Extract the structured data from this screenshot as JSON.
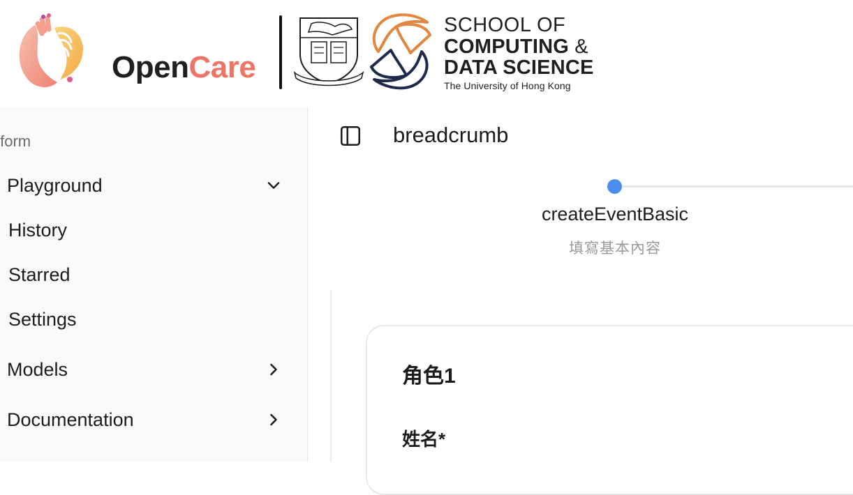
{
  "header": {
    "brand_open": "Open",
    "brand_care": "Care",
    "school": {
      "line1": "SCHOOL OF",
      "line2_main": "COMPUTING",
      "line2_amp": "&",
      "line3": "DATA SCIENCE",
      "line4": "The University of Hong Kong"
    },
    "colors": {
      "brand_dark": "#1f1f1f",
      "brand_coral": "#ee7466",
      "cds_orange": "#e2873f",
      "cds_navy": "#1e2a4a"
    }
  },
  "sidebar": {
    "group_label": "tform",
    "items": [
      {
        "label": "Playground",
        "chevron": "chevron-down-icon"
      },
      {
        "label": "History"
      },
      {
        "label": "Starred"
      },
      {
        "label": "Settings"
      },
      {
        "label": "Models",
        "chevron": "chevron-right-icon"
      },
      {
        "label": "Documentation",
        "chevron": "chevron-right-icon"
      }
    ]
  },
  "main": {
    "breadcrumb": "breadcrumb",
    "stepper": {
      "title": "createEventBasic",
      "subtitle": "填寫基本內容",
      "active_color": "#4d8df0"
    },
    "role_card": {
      "title": "角色1",
      "field_label": "姓名*"
    }
  }
}
